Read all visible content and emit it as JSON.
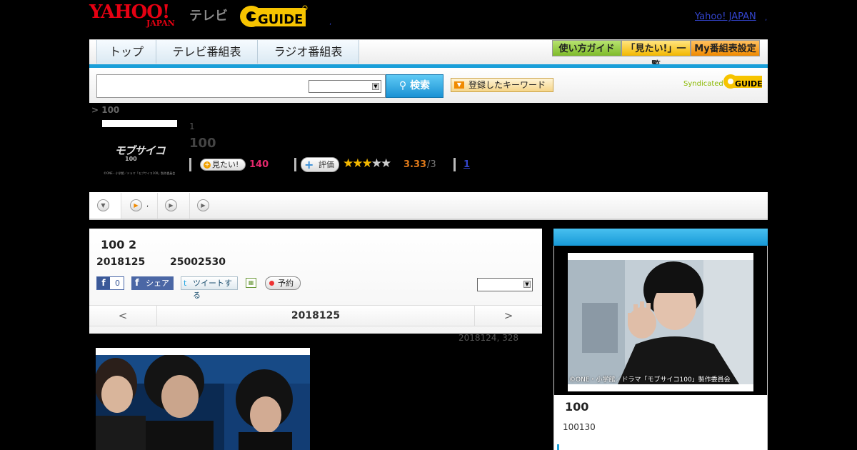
{
  "header": {
    "logo_yahoo": "YAHOO!",
    "logo_japan": "JAPAN",
    "logo_tv": "テレビ",
    "logo_gguide": "GUIDE",
    "yahoo_japan_link": "Yahoo! JAPAN",
    "dot": ","
  },
  "nav": {
    "tabs": [
      "トップ",
      "テレビ番組表",
      "ラジオ番組表"
    ],
    "right_buttons": [
      "使い方ガイド",
      "「見たい!」一覧",
      "My番組表設定"
    ]
  },
  "search": {
    "button_label": "検索",
    "keyword_button": "登録したキーワード",
    "syndicated": "Syndicated",
    "placeholder": ""
  },
  "program": {
    "breadcrumb": "> 100",
    "thumb_title": "モブサイコ",
    "thumb_sub": "100",
    "thumb_copy": "©ONE・小学館／ドラマ「モブサイコ100」製作委員会",
    "number": "1",
    "title": "100",
    "mitai_label": "見たい!",
    "mitai_count": "140",
    "hyoka_label": "評価",
    "rating_stars": 3,
    "rating_max": 5,
    "rating": "3.33",
    "rating_sub": "/3",
    "review_link": "1"
  },
  "tabs": {
    "items": [
      ",",
      ""
    ],
    "colors": {
      "active_icon": "#f08a00"
    }
  },
  "episode": {
    "title": "100 2",
    "date": "2018125",
    "time": "25002530",
    "fb_like_icon": "f",
    "fb_like_count": "0",
    "fb_share_icon": "f",
    "fb_share": "シェア",
    "tweet": "ツイートする",
    "tweet_icon": "t",
    "cal_icon": "▦",
    "yoyaku": "予約",
    "pager_prev": "<",
    "pager_date": "2018125",
    "pager_next": ">",
    "update_note": "2018124, 328"
  },
  "sidebar": {
    "photo_copy": "©ONE・小学館／ドラマ「モブサイコ100」製作委員会",
    "title": "100",
    "subtitle": "100130"
  },
  "colors": {
    "accent": "#1a9fd9",
    "yahoo_red": "#e60012",
    "mitai_pink": "#e6286d",
    "rating_orange": "#e07a1a",
    "link_blue": "#3344cc"
  }
}
